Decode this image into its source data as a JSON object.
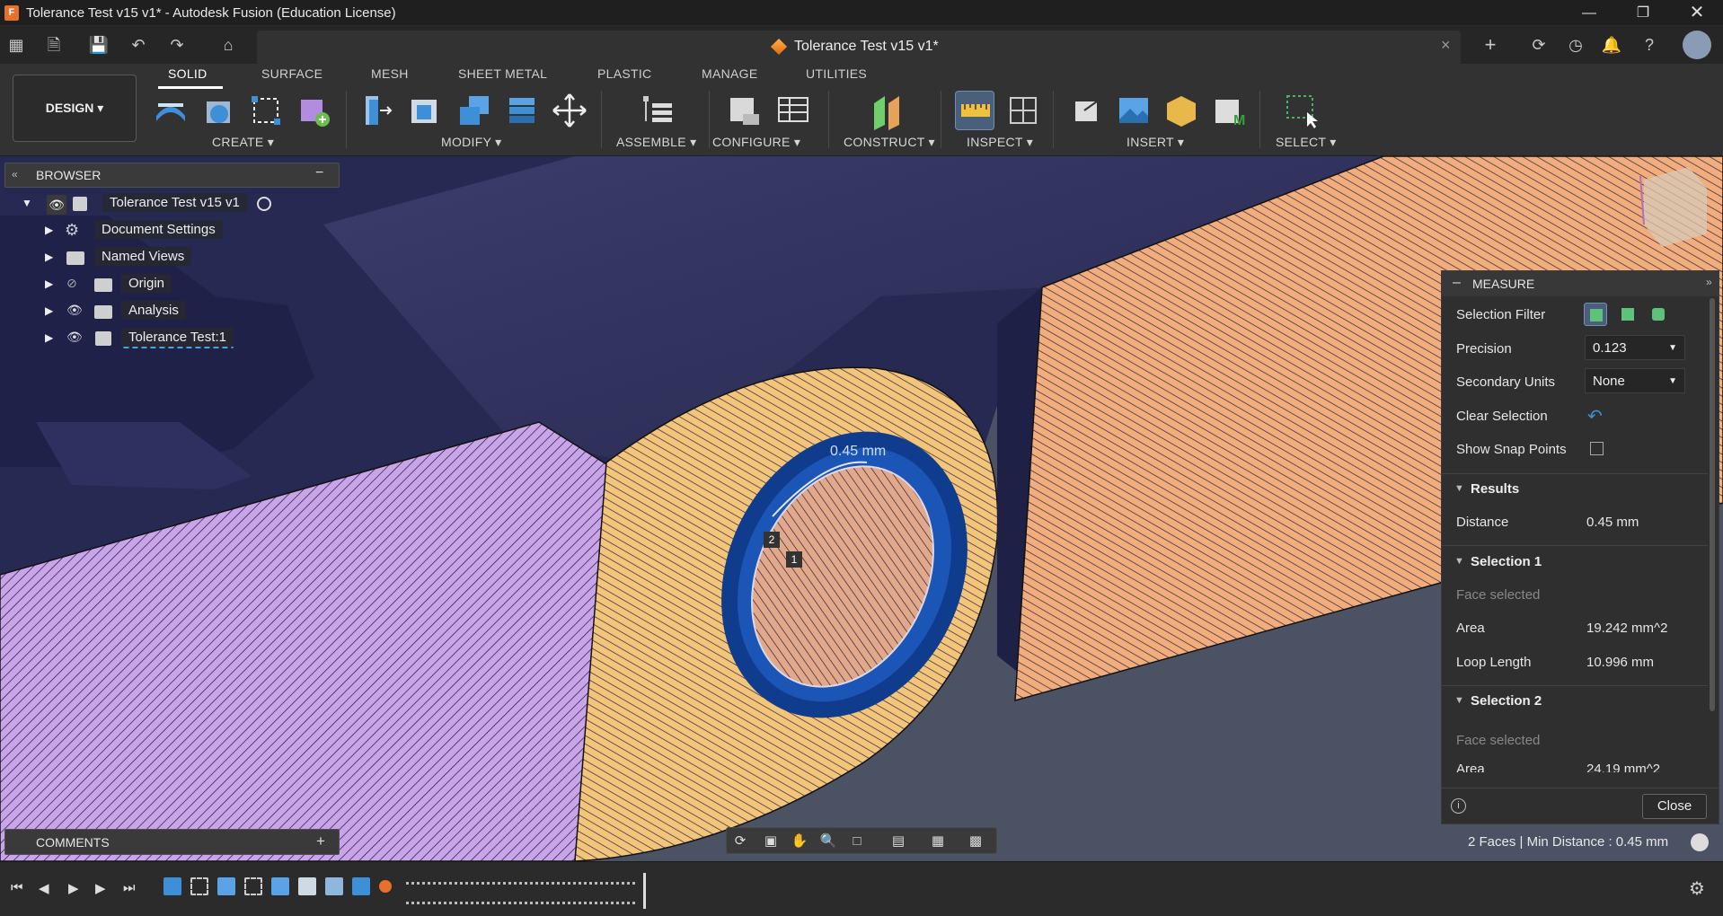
{
  "window": {
    "title": "Tolerance Test v15 v1* - Autodesk Fusion (Education License)",
    "app_icon": "F",
    "controls": [
      "minimize-icon",
      "restore-icon",
      "close-icon"
    ]
  },
  "doc_tab": {
    "label": "Tolerance Test v15 v1*",
    "close": "×"
  },
  "tabstrip": {
    "new_tab": "+"
  },
  "toolbar": {
    "workspace": "DESIGN ▾",
    "tabs": [
      "SOLID",
      "SURFACE",
      "MESH",
      "SHEET METAL",
      "PLASTIC",
      "MANAGE",
      "UTILITIES"
    ],
    "groups": [
      "CREATE ▾",
      "MODIFY ▾",
      "ASSEMBLE ▾",
      "CONFIGURE ▾",
      "CONSTRUCT ▾",
      "INSPECT ▾",
      "INSERT ▾",
      "SELECT ▾"
    ]
  },
  "browser": {
    "title": "BROWSER",
    "collapse": "−",
    "root": "Tolerance Test v15 v1",
    "items": [
      "Document Settings",
      "Named Views",
      "Origin",
      "Analysis",
      "Tolerance Test:1"
    ]
  },
  "viewport": {
    "dimension_label": "0.45 mm",
    "marker_1": "1",
    "marker_2": "2"
  },
  "measure": {
    "title": "MEASURE",
    "selection_filter_label": "Selection Filter",
    "precision_label": "Precision",
    "precision_value": "0.123",
    "secondary_units_label": "Secondary Units",
    "secondary_units_value": "None",
    "clear_selection_label": "Clear Selection",
    "show_snap_points_label": "Show Snap Points",
    "results_label": "Results",
    "distance_label": "Distance",
    "distance_value": "0.45 mm",
    "selection1_label": "Selection 1",
    "selection1_sub": "Face selected",
    "area_label": "Area",
    "area1_value": "19.242 mm^2",
    "loop_length_label": "Loop Length",
    "loop_length_value": "10.996 mm",
    "selection2_label": "Selection 2",
    "selection2_sub": "Face selected",
    "area2_value": "24.19 mm^2",
    "close_label": "Close"
  },
  "comments": {
    "label": "COMMENTS",
    "add": "+"
  },
  "status": "2 Faces | Min Distance : 0.45 mm",
  "colors": {
    "accent": "#1a5fb4",
    "face_orange": "#f2ad7c",
    "face_yellow": "#f3c57a",
    "face_purple": "#c9a4e8",
    "body_dark": "#2d2f58"
  }
}
